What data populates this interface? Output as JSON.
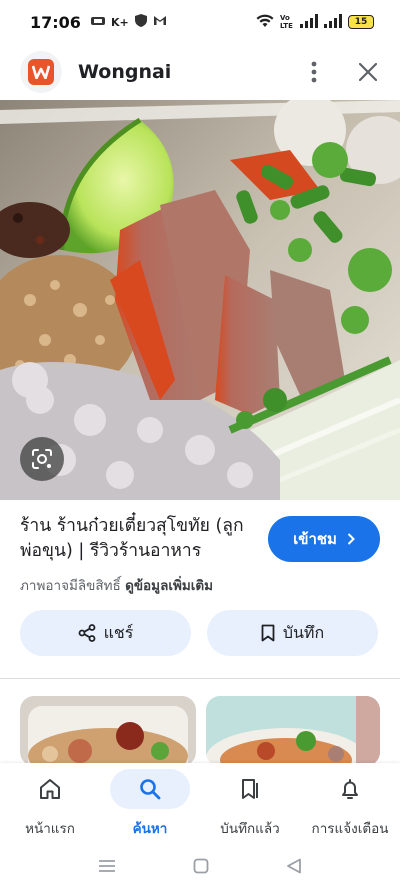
{
  "status_bar": {
    "time": "17:06",
    "left_icons": [
      "sim-icon",
      "k-plus-icon",
      "shield-icon",
      "gmail-icon"
    ],
    "k_plus_text": "K+",
    "volte_text": "Vo LTE",
    "battery": "15"
  },
  "app": {
    "title": "Wongnai",
    "logo_letter": "w",
    "brand_color": "#e8552a"
  },
  "place": {
    "title": "ร้าน ร้านก๋วยเตี๋ยวสุโขทัย (ลูกพ่อขุน) | รีวิวร้านอาหาร",
    "visit_label": "เข้าชม",
    "copyright_note": "ภาพอาจมีลิขสิทธิ์",
    "more_info": "ดูข้อมูลเพิ่มเติม"
  },
  "actions": {
    "share_label": "แชร์",
    "save_label": "บันทึก"
  },
  "nav": {
    "items": [
      {
        "label": "หน้าแรก",
        "icon": "home-icon"
      },
      {
        "label": "ค้นหา",
        "icon": "search-icon",
        "active": true
      },
      {
        "label": "บันทึกแล้ว",
        "icon": "saved-icon"
      },
      {
        "label": "การแจ้งเตือน",
        "icon": "bell-icon"
      }
    ]
  },
  "colors": {
    "accent": "#1a73e8",
    "pill_bg": "#e8f0fe"
  }
}
